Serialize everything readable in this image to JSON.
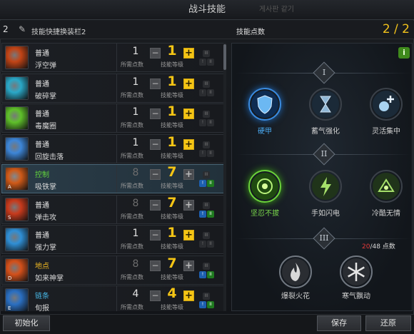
{
  "window": {
    "title": "战斗技能",
    "ghost_text": "게사판 같기"
  },
  "preset": {
    "number": "2",
    "label": "技能快捷换装栏2"
  },
  "skill_points": {
    "label": "技能点数",
    "value": "2 / 2"
  },
  "skills": [
    {
      "type": "普通",
      "type_color": "white",
      "name": "浮空弹",
      "required": "1",
      "required_label": "所需点数",
      "level": "1",
      "level_label": "技能等级",
      "plus_active": true,
      "tripod_active": false,
      "icon_color": "#c24416",
      "icon": "fireball-skill-icon"
    },
    {
      "type": "普通",
      "type_color": "white",
      "name": "破碎掌",
      "required": "1",
      "required_label": "所需点数",
      "level": "1",
      "level_label": "技能等级",
      "plus_active": true,
      "tripod_active": false,
      "icon_color": "#2aa8c8",
      "icon": "palm-shatter-skill-icon"
    },
    {
      "type": "普通",
      "type_color": "white",
      "name": "毒魔圈",
      "required": "1",
      "required_label": "所需点数",
      "level": "1",
      "level_label": "技能等级",
      "plus_active": true,
      "tripod_active": false,
      "icon_color": "#5fc02a",
      "icon": "poison-circle-skill-icon"
    },
    {
      "type": "普通",
      "type_color": "white",
      "name": "回旋击落",
      "required": "1",
      "required_label": "所需点数",
      "level": "1",
      "level_label": "技能等级",
      "plus_active": true,
      "tripod_active": false,
      "icon_color": "#3d86d8",
      "icon": "spin-strike-skill-icon"
    },
    {
      "type": "控制",
      "type_color": "green",
      "name": "吸铁掌",
      "required": "8",
      "required_label": "所需点数",
      "level": "7",
      "level_label": "技能等级",
      "plus_active": false,
      "tripod_active": true,
      "icon_color": "#d05a18",
      "icon": "magnet-palm-skill-icon",
      "key": "A"
    },
    {
      "type": "普通",
      "type_color": "white",
      "name": "弹击攻",
      "required": "8",
      "required_label": "所需点数",
      "level": "7",
      "level_label": "技能等级",
      "plus_active": false,
      "tripod_active": true,
      "icon_color": "#c83a1c",
      "icon": "bounce-attack-skill-icon",
      "key": "S"
    },
    {
      "type": "普通",
      "type_color": "white",
      "name": "强力掌",
      "required": "1",
      "required_label": "所需点数",
      "level": "1",
      "level_label": "技能等级",
      "plus_active": true,
      "tripod_active": false,
      "icon_color": "#2f8fd6",
      "icon": "power-palm-skill-icon"
    },
    {
      "type": "地点",
      "type_color": "yellow",
      "name": "如来神掌",
      "required": "8",
      "required_label": "所需点数",
      "level": "7",
      "level_label": "技能等级",
      "plus_active": false,
      "tripod_active": true,
      "icon_color": "#d4501a",
      "icon": "buddha-palm-skill-icon",
      "key": "D"
    },
    {
      "type": "链条",
      "type_color": "cyan",
      "name": "旬报",
      "required": "4",
      "required_label": "所需点数",
      "level": "4",
      "level_label": "技能等级",
      "plus_active": true,
      "tripod_active": true,
      "icon_color": "#2a6fc2",
      "icon": "chain-skill-icon",
      "key": "E"
    }
  ],
  "tiers": [
    "I",
    "II",
    "III"
  ],
  "tripods": {
    "tier1": [
      {
        "label": "硬甲",
        "state": "selected-blue",
        "icon": "shield-icon"
      },
      {
        "label": "蓄气强化",
        "state": "normal",
        "icon": "hourglass-icon"
      },
      {
        "label": "灵活集中",
        "state": "normal",
        "icon": "orb-plus-icon"
      }
    ],
    "tier2": [
      {
        "label": "坚忍不拔",
        "state": "selected-green",
        "icon": "endurance-icon"
      },
      {
        "label": "手如闪电",
        "state": "normal",
        "icon": "lightning-hand-icon"
      },
      {
        "label": "冷酷无情",
        "state": "normal",
        "icon": "ruthless-icon"
      }
    ],
    "tier3": [
      {
        "label": "爆裂火花",
        "state": "locked",
        "icon": "flame-icon"
      },
      {
        "label": "寒气飘动",
        "state": "locked",
        "icon": "snowflake-icon"
      }
    ]
  },
  "tier3_requirement": {
    "current": "20",
    "rest": "/48 点数"
  },
  "buttons": {
    "reset": "初始化",
    "save": "保存",
    "restore": "还原"
  }
}
